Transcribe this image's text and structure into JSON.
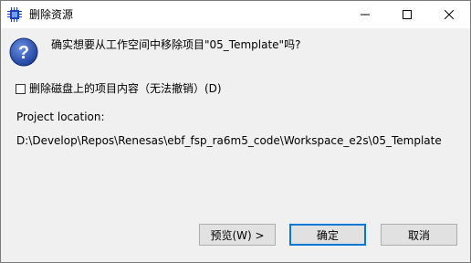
{
  "window": {
    "title": "删除资源",
    "app_icon": "chip-icon",
    "controls": {
      "minimize_icon": "minimize-icon",
      "maximize_icon": "maximize-icon",
      "close_icon": "close-icon"
    }
  },
  "dialog": {
    "icon": "question-icon",
    "message": "确实想要从工作空间中移除项目\"05_Template\"吗?",
    "delete_contents_label": "删除磁盘上的项目内容（无法撤销）(D)",
    "delete_contents_checked": false,
    "location_label": "Project location:",
    "location_path": "D:\\Develop\\Repos\\Renesas\\ebf_fsp_ra6m5_code\\Workspace_e2s\\05_Template"
  },
  "buttons": {
    "preview": "预览(W) >",
    "ok": "确定",
    "cancel": "取消"
  },
  "colors": {
    "accent": "#0078d7",
    "titlebar": "#ffffff",
    "body": "#f0f0f0"
  }
}
